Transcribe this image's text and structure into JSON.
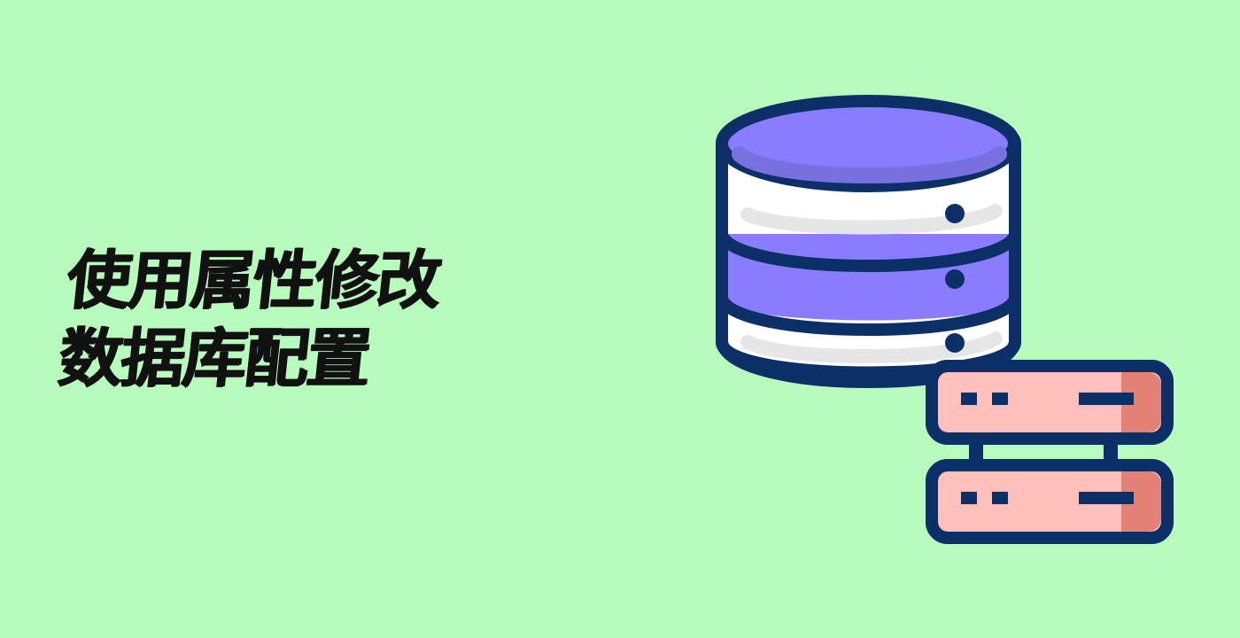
{
  "page": {
    "background": "#b7fbbd"
  },
  "title": {
    "line1": "使用属性修改",
    "line2": "数据库配置"
  },
  "illustration": {
    "database_icon": "database-stack-icon",
    "server_icon": "server-rack-icon",
    "colors": {
      "outline": "#0d2f67",
      "purple": "#8a7cff",
      "white": "#ffffff",
      "pink": "#ffc0bb",
      "salmon": "#e48176"
    }
  }
}
